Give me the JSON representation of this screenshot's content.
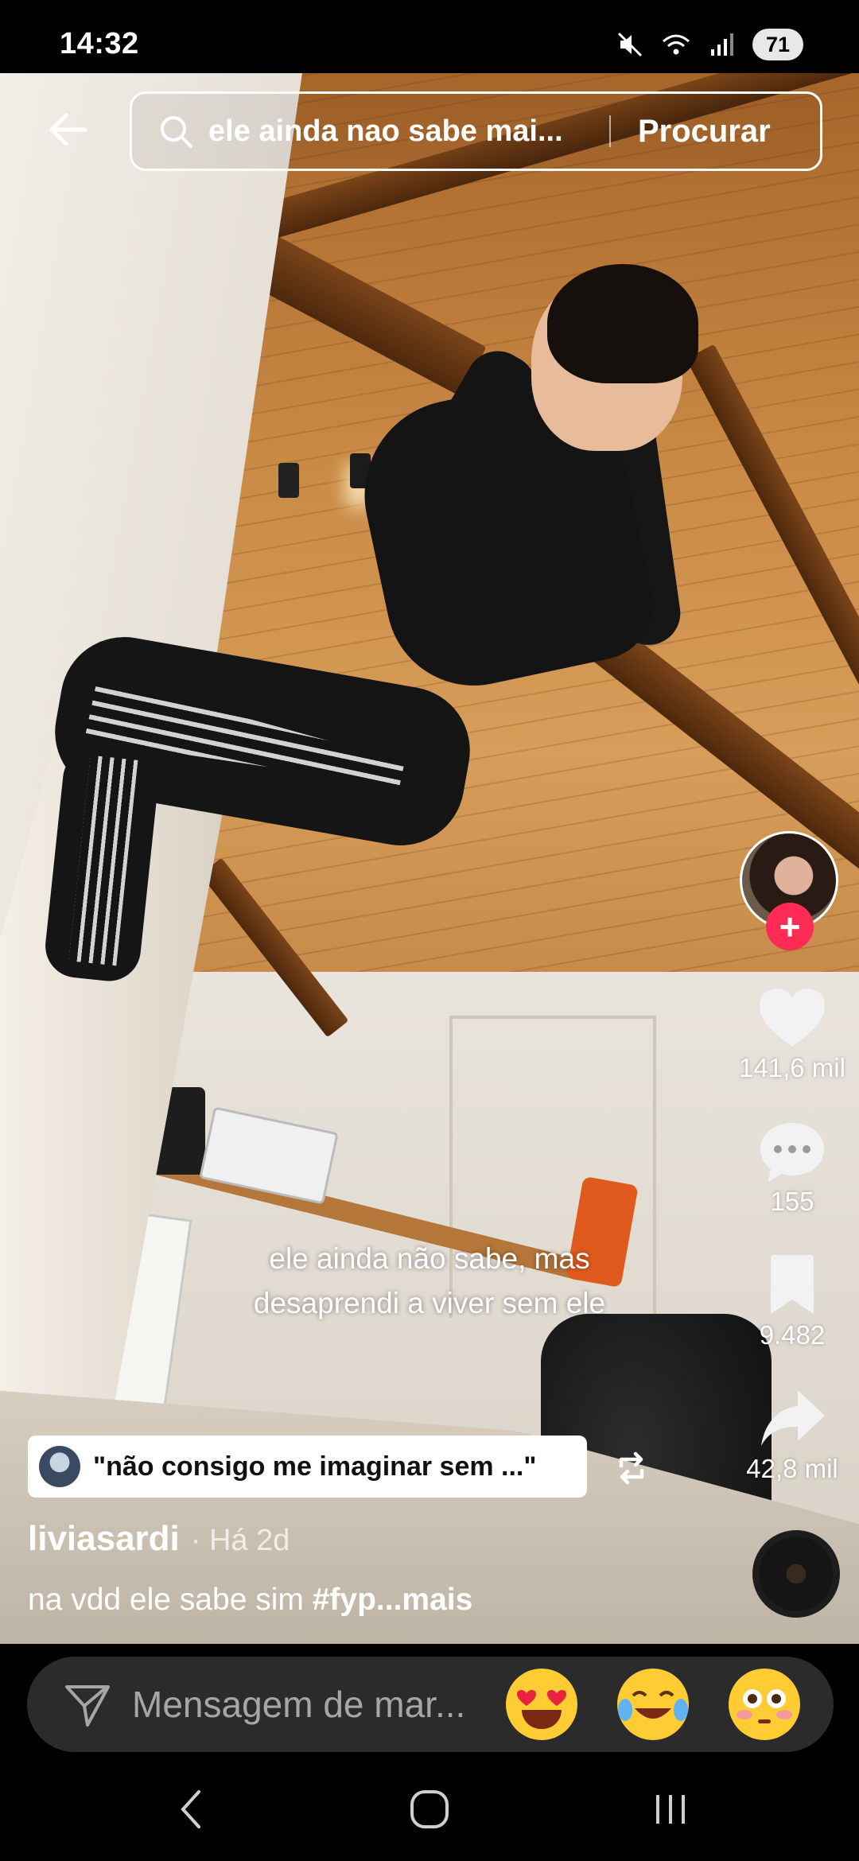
{
  "status_bar": {
    "time": "14:32",
    "battery": "71",
    "icons": [
      "mute-icon",
      "wifi-icon",
      "signal-icon",
      "battery-icon"
    ]
  },
  "search": {
    "query": "ele ainda nao sabe mai...",
    "button_label": "Procurar"
  },
  "video": {
    "caption_line1": "ele ainda não sabe, mas",
    "caption_line2": "desaprendi a viver sem ele"
  },
  "actions": {
    "like_count": "141,6 mil",
    "comment_count": "155",
    "save_count": "9.482",
    "share_count": "42,8 mil"
  },
  "post": {
    "quote": "\"não consigo me imaginar sem ...\"",
    "author": "liviasardi",
    "time": "· Há 2d",
    "description": "na vdd ele sabe sim ",
    "hashtag": "#fyp...mais"
  },
  "comment_bar": {
    "placeholder": "Mensagem de mar...",
    "emojis": [
      "heart-eyes-emoji",
      "tears-of-joy-emoji",
      "flushed-emoji"
    ]
  },
  "colors": {
    "accent": "#fe2c55",
    "background": "#000000",
    "input_bg": "#2b2b2b"
  }
}
